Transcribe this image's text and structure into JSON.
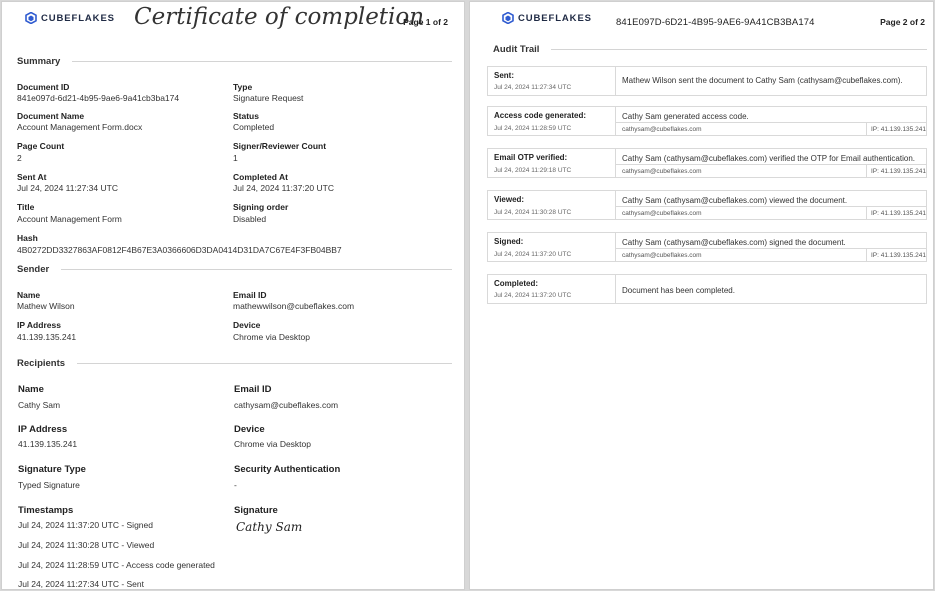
{
  "page1": {
    "brand": "CUBEFLAKES",
    "title": "Certificate of completion",
    "page_number": "Page 1 of 2",
    "summary": {
      "heading": "Summary",
      "fields": [
        {
          "label": "Document ID",
          "value": "841e097d-6d21-4b95-9ae6-9a41cb3ba174"
        },
        {
          "label": "Type",
          "value": "Signature Request"
        },
        {
          "label": "Document Name",
          "value": "Account Management Form.docx"
        },
        {
          "label": "Status",
          "value": "Completed"
        },
        {
          "label": "Page Count",
          "value": "2"
        },
        {
          "label": "Signer/Reviewer Count",
          "value": "1"
        },
        {
          "label": "Sent At",
          "value": "Jul 24, 2024 11:27:34 UTC"
        },
        {
          "label": "Completed At",
          "value": "Jul 24, 2024 11:37:20 UTC"
        },
        {
          "label": "Title",
          "value": "Account Management Form"
        },
        {
          "label": "Signing order",
          "value": "Disabled"
        },
        {
          "label": "Hash",
          "value": "4B0272DD3327863AF0812F4B67E3A0366606D3DA0414D31DA7C67E4F3FB04BB7"
        }
      ]
    },
    "sender": {
      "heading": "Sender",
      "fields": [
        {
          "label": "Name",
          "value": "Mathew Wilson"
        },
        {
          "label": "Email ID",
          "value": "mathewwilson@cubeflakes.com"
        },
        {
          "label": "IP Address",
          "value": "41.139.135.241"
        },
        {
          "label": "Device",
          "value": "Chrome via Desktop"
        }
      ]
    },
    "recipients": {
      "heading": "Recipients",
      "fields": [
        {
          "label": "Name",
          "value": "Cathy Sam"
        },
        {
          "label": "Email ID",
          "value": "cathysam@cubeflakes.com"
        },
        {
          "label": "IP Address",
          "value": "41.139.135.241"
        },
        {
          "label": "Device",
          "value": "Chrome via Desktop"
        },
        {
          "label": "Signature Type",
          "value": "Typed Signature"
        },
        {
          "label": "Security Authentication",
          "value": "-"
        }
      ],
      "timestamps_label": "Timestamps",
      "timestamps": [
        "Jul 24, 2024 11:37:20 UTC - Signed",
        "Jul 24, 2024 11:30:28 UTC - Viewed",
        "Jul 24, 2024 11:28:59 UTC - Access code generated",
        "Jul 24, 2024 11:27:34 UTC - Sent"
      ],
      "signature_label": "Signature",
      "signature": "Cathy Sam"
    }
  },
  "page2": {
    "brand": "CUBEFLAKES",
    "document_id": "841E097D-6D21-4B95-9AE6-9A41CB3BA174",
    "page_number": "Page 2 of 2",
    "audit_heading": "Audit Trail",
    "events": [
      {
        "label": "Sent:",
        "time": "Jul 24, 2024 11:27:34 UTC",
        "description": "Mathew Wilson sent the document to Cathy Sam (cathysam@cubeflakes.com).",
        "email": "",
        "ip": ""
      },
      {
        "label": "Access code generated:",
        "time": "Jul 24, 2024 11:28:59 UTC",
        "description": "Cathy Sam generated access code.",
        "email": "cathysam@cubeflakes.com",
        "ip": "IP: 41.139.135.241"
      },
      {
        "label": "Email OTP verified:",
        "time": "Jul 24, 2024 11:29:18 UTC",
        "description": "Cathy Sam (cathysam@cubeflakes.com) verified the OTP for Email authentication.",
        "email": "cathysam@cubeflakes.com",
        "ip": "IP: 41.139.135.241"
      },
      {
        "label": "Viewed:",
        "time": "Jul 24, 2024 11:30:28 UTC",
        "description": "Cathy Sam (cathysam@cubeflakes.com) viewed the document.",
        "email": "cathysam@cubeflakes.com",
        "ip": "IP: 41.139.135.241"
      },
      {
        "label": "Signed:",
        "time": "Jul 24, 2024 11:37:20 UTC",
        "description": "Cathy Sam (cathysam@cubeflakes.com) signed the document.",
        "email": "cathysam@cubeflakes.com",
        "ip": "IP: 41.139.135.241"
      },
      {
        "label": "Completed:",
        "time": "Jul 24, 2024 11:37:20 UTC",
        "description": "Document has been completed.",
        "email": "",
        "ip": ""
      }
    ]
  }
}
